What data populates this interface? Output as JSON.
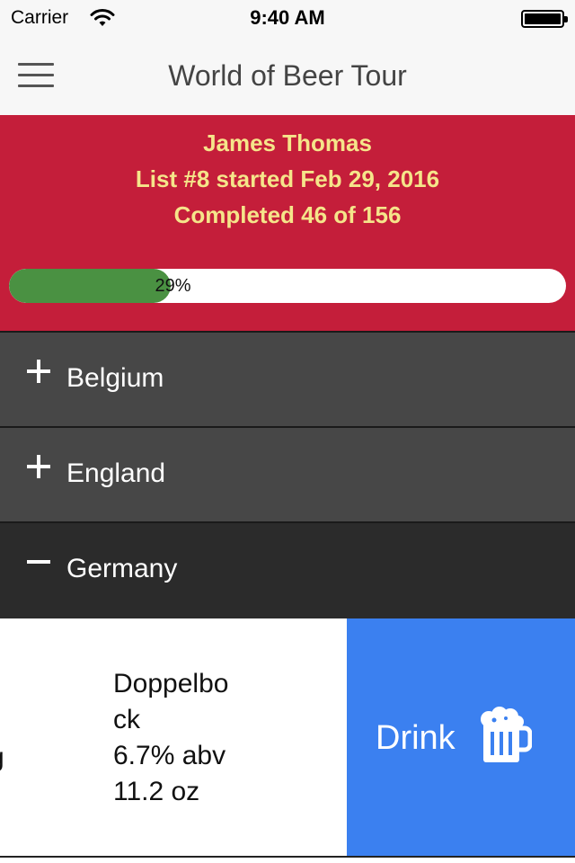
{
  "status_bar": {
    "carrier": "Carrier",
    "time": "9:40 AM",
    "wifi_icon": "wifi-icon",
    "battery_icon": "battery-icon"
  },
  "nav": {
    "title": "World of Beer Tour",
    "menu_icon": "hamburger-menu-icon"
  },
  "profile": {
    "name": "James Thomas",
    "list_info": "List #8 started Feb 29, 2016",
    "completed": "Completed 46 of 156"
  },
  "progress": {
    "label": "29%",
    "value": 0.29
  },
  "sections": [
    {
      "label": "Belgium",
      "icon": "plus-icon",
      "expanded": false
    },
    {
      "label": "England",
      "icon": "plus-icon",
      "expanded": false
    },
    {
      "label": "Germany",
      "icon": "minus-icon",
      "expanded": true
    }
  ],
  "beer": {
    "name_partial": "g",
    "style_line1": "Doppelbo",
    "style_line2": "ck",
    "abv": "6.7% abv",
    "size": "11.2 oz"
  },
  "drink_button": {
    "label": "Drink",
    "icon": "beer-mug-icon"
  },
  "colors": {
    "header_bg": "#c41e3a",
    "header_text": "#f5e58a",
    "progress_fill": "#4a9142",
    "section_bg": "#474747",
    "section_active_bg": "#2b2b2b",
    "drink_bg": "#3b80f0"
  }
}
